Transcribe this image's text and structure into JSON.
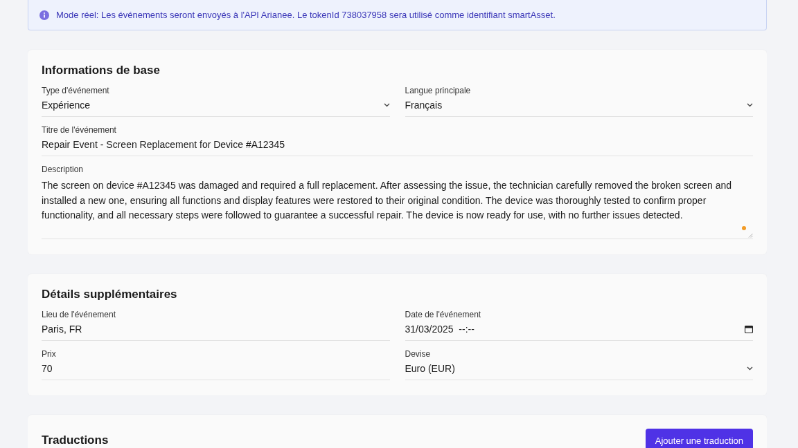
{
  "notice": {
    "text": "Mode réel: Les événements seront envoyés à l'API Arianee. Le tokenId 738037958 sera utilisé comme identifiant smartAsset."
  },
  "sections": [
    {
      "title": "Informations de base",
      "rows": [
        [
          {
            "kind": "select",
            "label": "Type d'événement",
            "value": "Expérience"
          },
          {
            "kind": "select",
            "label": "Langue principale",
            "value": "Français"
          }
        ],
        [
          {
            "kind": "text",
            "label": "Titre de l'événement",
            "value": "Repair Event - Screen Replacement for Device #A12345"
          }
        ],
        [
          {
            "kind": "textarea",
            "label": "Description",
            "value": "The screen on device #A12345 was damaged and required a full replacement. After assessing the issue, the technician carefully removed the broken screen and installed a new one, ensuring all functions and display features were restored to their original condition. The device was thoroughly tested to confirm proper functionality, and all necessary steps were followed to guarantee a successful repair. The device is now ready for use, with no further issues detected."
          }
        ]
      ]
    },
    {
      "title": "Détails supplémentaires",
      "rows": [
        [
          {
            "kind": "text",
            "label": "Lieu de l'événement",
            "value": "Paris, FR"
          },
          {
            "kind": "date",
            "label": "Date de l'événement",
            "value": "31/03/2025  --:--"
          }
        ],
        [
          {
            "kind": "text",
            "label": "Prix",
            "value": "70"
          },
          {
            "kind": "select",
            "label": "Devise",
            "value": "Euro (EUR)"
          }
        ]
      ]
    },
    {
      "title": "Traductions",
      "button": "Ajouter une traduction"
    }
  ]
}
